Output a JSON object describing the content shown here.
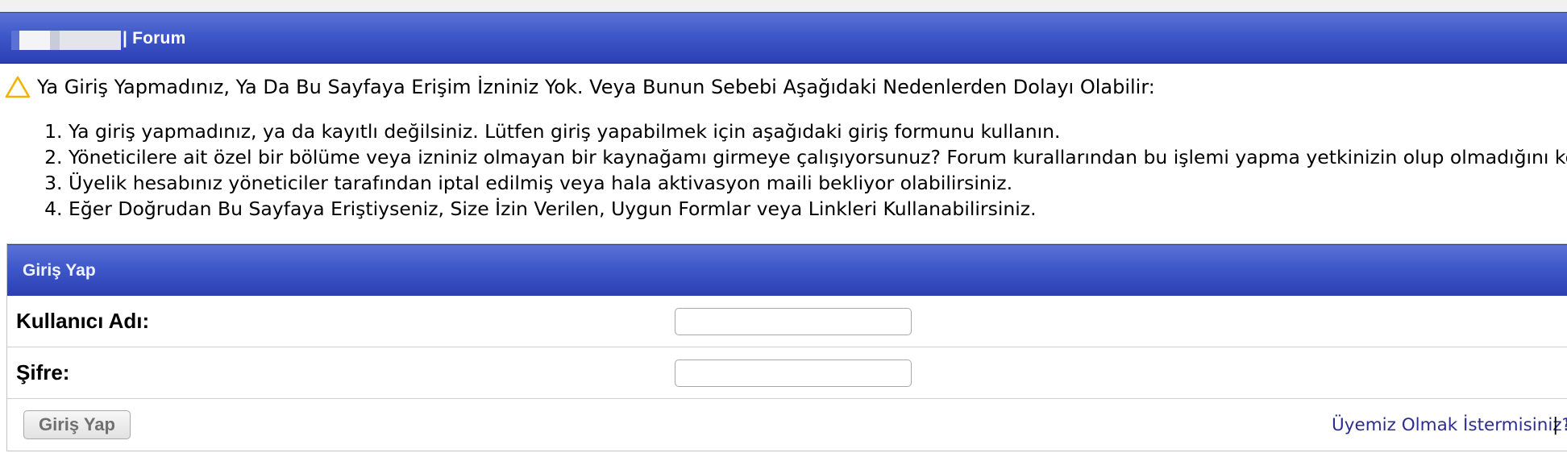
{
  "header": {
    "title": "| Forum"
  },
  "notice": {
    "icon": "warning-triangle-icon",
    "icon_color": "#f0b400",
    "message": "Ya Giriş Yapmadınız, Ya Da Bu Sayfaya Erişim İzniniz Yok. Veya Bunun Sebebi Aşağıdaki Nedenlerden Dolayı Olabilir:",
    "reasons": [
      "Ya giriş yapmadınız, ya da kayıtlı değilsiniz. Lütfen giriş yapabilmek için aşağıdaki giriş formunu kullanın.",
      "Yöneticilere ait özel bir bölüme veya izniniz olmayan bir kaynağamı girmeye çalışıyorsunuz? Forum kurallarından bu işlemi yapma yetkinizin olup olmadığını kontrol",
      "Üyelik hesabınız yöneticiler tarafından iptal edilmiş veya hala aktivasyon maili bekliyor olabilirsiniz.",
      "Eğer Doğrudan Bu Sayfaya Eriştiyseniz, Size İzin Verilen, Uygun Formlar veya Linkleri Kullanabilirsiniz."
    ]
  },
  "login": {
    "title": "Giriş Yap",
    "username_label": "Kullanıcı Adı:",
    "username_value": "",
    "password_label": "Şifre:",
    "password_value": "",
    "submit_label": "Giriş Yap",
    "register_link": "Üyemiz Olmak İstermisiniz?",
    "separator": "|",
    "next_link_fragment": "S"
  },
  "colors": {
    "header_blue": "#3f58c9",
    "link": "#2d2d8f"
  }
}
